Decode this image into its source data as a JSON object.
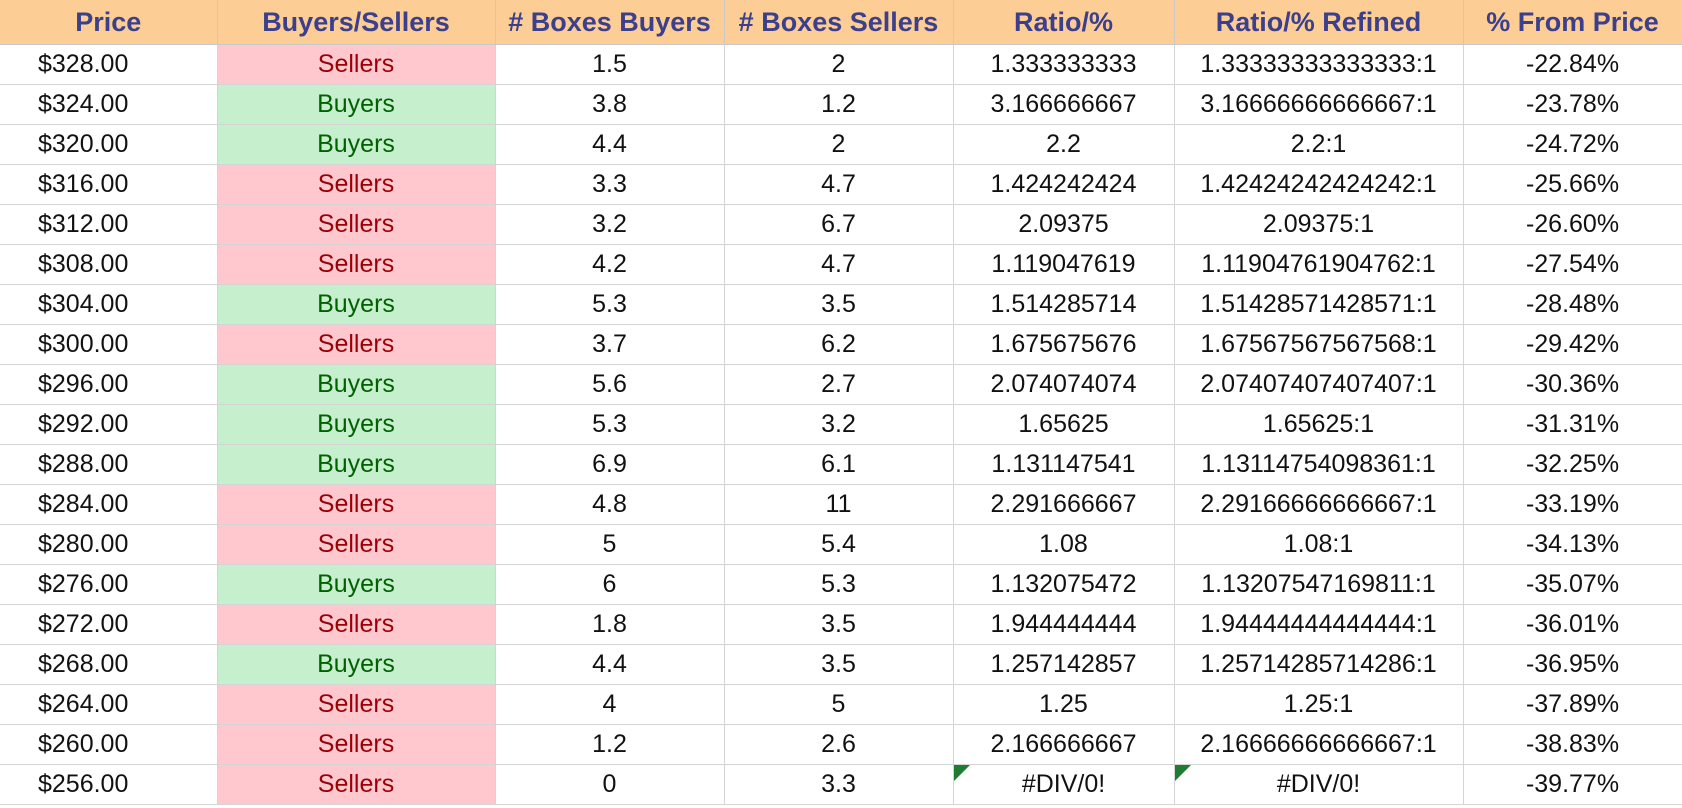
{
  "headers": [
    "Price",
    "Buyers/Sellers",
    "# Boxes Buyers",
    "# Boxes Sellers",
    "Ratio/%",
    "Ratio/% Refined",
    "% From Price"
  ],
  "rows": [
    {
      "price": "$328.00",
      "side": "Sellers",
      "boxes_buyers": "1.5",
      "boxes_sellers": "2",
      "ratio": "1.333333333",
      "ratio_refined": "1.33333333333333:1",
      "from_price": "-22.84%"
    },
    {
      "price": "$324.00",
      "side": "Buyers",
      "boxes_buyers": "3.8",
      "boxes_sellers": "1.2",
      "ratio": "3.166666667",
      "ratio_refined": "3.16666666666667:1",
      "from_price": "-23.78%"
    },
    {
      "price": "$320.00",
      "side": "Buyers",
      "boxes_buyers": "4.4",
      "boxes_sellers": "2",
      "ratio": "2.2",
      "ratio_refined": "2.2:1",
      "from_price": "-24.72%"
    },
    {
      "price": "$316.00",
      "side": "Sellers",
      "boxes_buyers": "3.3",
      "boxes_sellers": "4.7",
      "ratio": "1.424242424",
      "ratio_refined": "1.42424242424242:1",
      "from_price": "-25.66%"
    },
    {
      "price": "$312.00",
      "side": "Sellers",
      "boxes_buyers": "3.2",
      "boxes_sellers": "6.7",
      "ratio": "2.09375",
      "ratio_refined": "2.09375:1",
      "from_price": "-26.60%"
    },
    {
      "price": "$308.00",
      "side": "Sellers",
      "boxes_buyers": "4.2",
      "boxes_sellers": "4.7",
      "ratio": "1.119047619",
      "ratio_refined": "1.11904761904762:1",
      "from_price": "-27.54%"
    },
    {
      "price": "$304.00",
      "side": "Buyers",
      "boxes_buyers": "5.3",
      "boxes_sellers": "3.5",
      "ratio": "1.514285714",
      "ratio_refined": "1.51428571428571:1",
      "from_price": "-28.48%"
    },
    {
      "price": "$300.00",
      "side": "Sellers",
      "boxes_buyers": "3.7",
      "boxes_sellers": "6.2",
      "ratio": "1.675675676",
      "ratio_refined": "1.67567567567568:1",
      "from_price": "-29.42%"
    },
    {
      "price": "$296.00",
      "side": "Buyers",
      "boxes_buyers": "5.6",
      "boxes_sellers": "2.7",
      "ratio": "2.074074074",
      "ratio_refined": "2.07407407407407:1",
      "from_price": "-30.36%"
    },
    {
      "price": "$292.00",
      "side": "Buyers",
      "boxes_buyers": "5.3",
      "boxes_sellers": "3.2",
      "ratio": "1.65625",
      "ratio_refined": "1.65625:1",
      "from_price": "-31.31%"
    },
    {
      "price": "$288.00",
      "side": "Buyers",
      "boxes_buyers": "6.9",
      "boxes_sellers": "6.1",
      "ratio": "1.131147541",
      "ratio_refined": "1.13114754098361:1",
      "from_price": "-32.25%"
    },
    {
      "price": "$284.00",
      "side": "Sellers",
      "boxes_buyers": "4.8",
      "boxes_sellers": "11",
      "ratio": "2.291666667",
      "ratio_refined": "2.29166666666667:1",
      "from_price": "-33.19%"
    },
    {
      "price": "$280.00",
      "side": "Sellers",
      "boxes_buyers": "5",
      "boxes_sellers": "5.4",
      "ratio": "1.08",
      "ratio_refined": "1.08:1",
      "from_price": "-34.13%"
    },
    {
      "price": "$276.00",
      "side": "Buyers",
      "boxes_buyers": "6",
      "boxes_sellers": "5.3",
      "ratio": "1.132075472",
      "ratio_refined": "1.13207547169811:1",
      "from_price": "-35.07%"
    },
    {
      "price": "$272.00",
      "side": "Sellers",
      "boxes_buyers": "1.8",
      "boxes_sellers": "3.5",
      "ratio": "1.944444444",
      "ratio_refined": "1.94444444444444:1",
      "from_price": "-36.01%"
    },
    {
      "price": "$268.00",
      "side": "Buyers",
      "boxes_buyers": "4.4",
      "boxes_sellers": "3.5",
      "ratio": "1.257142857",
      "ratio_refined": "1.25714285714286:1",
      "from_price": "-36.95%"
    },
    {
      "price": "$264.00",
      "side": "Sellers",
      "boxes_buyers": "4",
      "boxes_sellers": "5",
      "ratio": "1.25",
      "ratio_refined": "1.25:1",
      "from_price": "-37.89%"
    },
    {
      "price": "$260.00",
      "side": "Sellers",
      "boxes_buyers": "1.2",
      "boxes_sellers": "2.6",
      "ratio": "2.166666667",
      "ratio_refined": "2.16666666666667:1",
      "from_price": "-38.83%"
    },
    {
      "price": "$256.00",
      "side": "Sellers",
      "boxes_buyers": "0",
      "boxes_sellers": "3.3",
      "ratio": "#DIV/0!",
      "ratio_refined": "#DIV/0!",
      "from_price": "-39.77%",
      "error": true
    }
  ],
  "colors": {
    "header_bg": "#fccd94",
    "header_text": "#3b3f8c",
    "sellers_bg": "#ffc7ce",
    "sellers_text": "#9c0006",
    "buyers_bg": "#c6efce",
    "buyers_text": "#006100",
    "error_flag": "#1e7d32"
  }
}
